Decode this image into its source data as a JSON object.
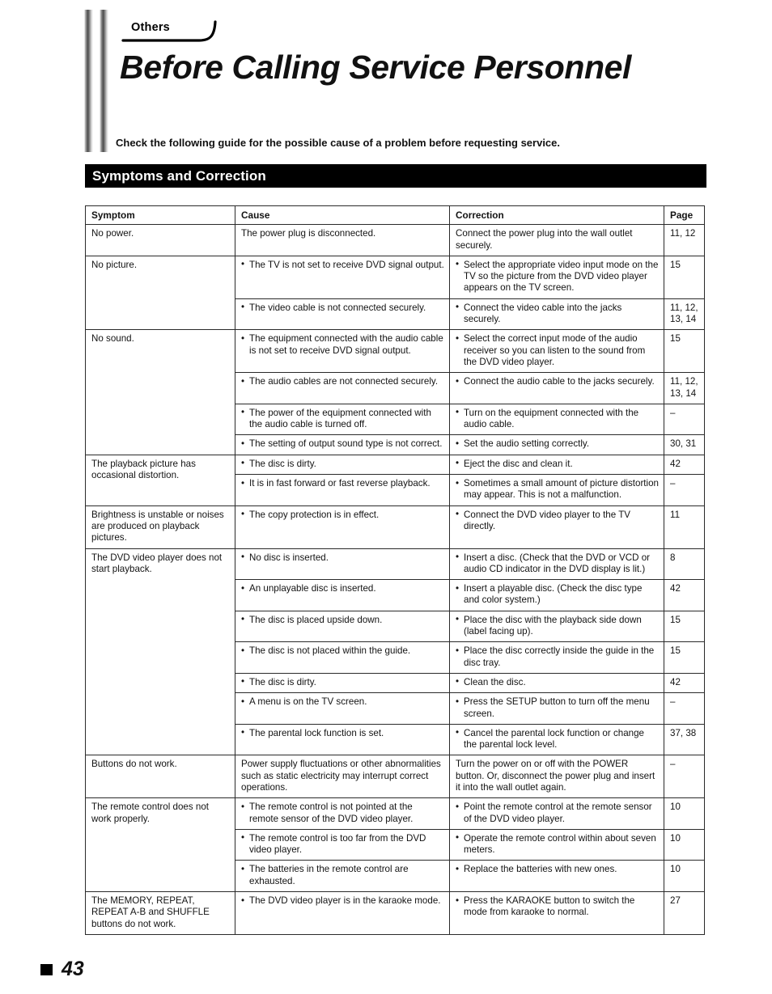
{
  "header": {
    "tab_label": "Others",
    "title": "Before Calling Service Personnel",
    "intro": "Check the following guide for the possible cause of a problem before requesting service.",
    "section_bar_label": "Symptoms and Correction"
  },
  "table": {
    "columns": [
      "Symptom",
      "Cause",
      "Correction",
      "Page"
    ],
    "groups": [
      {
        "symptom": "No power.",
        "rows": [
          {
            "cause": "The power plug is disconnected.",
            "cause_bullet": false,
            "correction": "Connect the power plug into the wall outlet securely.",
            "correction_bullet": false,
            "page": "11, 12"
          }
        ]
      },
      {
        "symptom": "No picture.",
        "rows": [
          {
            "cause": "The TV is not set to receive DVD signal output.",
            "cause_bullet": true,
            "correction": "Select the appropriate video input mode on the TV so the picture from the DVD video player appears on the TV screen.",
            "correction_bullet": true,
            "page": "15"
          },
          {
            "cause": "The video cable is not connected securely.",
            "cause_bullet": true,
            "correction": "Connect the video cable into the jacks securely.",
            "correction_bullet": true,
            "page": "11, 12,\n13, 14"
          }
        ]
      },
      {
        "symptom": "No sound.",
        "rows": [
          {
            "cause": "The equipment connected with the audio cable is not set to receive DVD signal output.",
            "cause_bullet": true,
            "correction": "Select the correct input mode of the audio receiver so you can listen to the sound from the DVD video player.",
            "correction_bullet": true,
            "page": "15"
          },
          {
            "cause": "The audio cables are not connected securely.",
            "cause_bullet": true,
            "correction": "Connect the audio cable to the jacks securely.",
            "correction_bullet": true,
            "page": "11, 12,\n13, 14"
          },
          {
            "cause": "The power of the equipment connected with the audio cable is turned off.",
            "cause_bullet": true,
            "correction": "Turn on the equipment connected with the audio cable.",
            "correction_bullet": true,
            "page": "–"
          },
          {
            "cause": "The setting of output sound type is not correct.",
            "cause_bullet": true,
            "correction": "Set the audio setting correctly.",
            "correction_bullet": true,
            "page": "30, 31"
          }
        ]
      },
      {
        "symptom": "The playback picture has occasional distortion.",
        "rows": [
          {
            "cause": "The disc is dirty.",
            "cause_bullet": true,
            "correction": "Eject the disc and clean it.",
            "correction_bullet": true,
            "page": "42"
          },
          {
            "cause": "It is in fast forward or fast reverse playback.",
            "cause_bullet": true,
            "correction": "Sometimes a small amount of picture distortion may appear. This is not a malfunction.",
            "correction_bullet": true,
            "page": "–"
          }
        ]
      },
      {
        "symptom": "Brightness is unstable or noises are produced on playback pictures.",
        "rows": [
          {
            "cause": "The copy protection is in effect.",
            "cause_bullet": true,
            "correction": "Connect the DVD video player to the TV directly.",
            "correction_bullet": true,
            "page": "11"
          }
        ]
      },
      {
        "symptom": "The DVD video player does not start playback.",
        "rows": [
          {
            "cause": "No disc is inserted.",
            "cause_bullet": true,
            "correction": "Insert a disc. (Check that the DVD or VCD or audio CD indicator in the DVD display is lit.)",
            "correction_bullet": true,
            "page": "8"
          },
          {
            "cause": "An unplayable disc is inserted.",
            "cause_bullet": true,
            "correction": "Insert a playable disc. (Check the disc type and color system.)",
            "correction_bullet": true,
            "page": "42"
          },
          {
            "cause": "The disc is placed upside down.",
            "cause_bullet": true,
            "correction": "Place the disc with the playback side down (label facing up).",
            "correction_bullet": true,
            "page": "15"
          },
          {
            "cause": "The disc is not placed within the guide.",
            "cause_bullet": true,
            "correction": "Place the disc correctly inside the guide in the disc tray.",
            "correction_bullet": true,
            "page": "15"
          },
          {
            "cause": "The disc is dirty.",
            "cause_bullet": true,
            "correction": "Clean the disc.",
            "correction_bullet": true,
            "page": "42"
          },
          {
            "cause": "A menu is on the TV screen.",
            "cause_bullet": true,
            "correction": "Press the SETUP button to turn off the menu screen.",
            "correction_bullet": true,
            "page": "–"
          },
          {
            "cause": "The parental lock function is set.",
            "cause_bullet": true,
            "correction": "Cancel the parental lock function or change the parental lock level.",
            "correction_bullet": true,
            "page": "37, 38"
          }
        ]
      },
      {
        "symptom": "Buttons do not work.",
        "rows": [
          {
            "cause": "Power supply fluctuations or other abnormalities such as static electricity may interrupt correct operations.",
            "cause_bullet": false,
            "correction": "Turn the power on or off with the POWER button. Or, disconnect the power plug and insert it into the wall outlet again.",
            "correction_bullet": false,
            "page": "–"
          }
        ]
      },
      {
        "symptom": "The remote control does not work properly.",
        "rows": [
          {
            "cause": "The remote control is not pointed at the remote sensor of the DVD video player.",
            "cause_bullet": true,
            "correction": "Point the remote control at the remote sensor of the DVD video player.",
            "correction_bullet": true,
            "page": "10"
          },
          {
            "cause": "The remote control is too far from the DVD video player.",
            "cause_bullet": true,
            "correction": "Operate the remote control within about seven meters.",
            "correction_bullet": true,
            "page": "10"
          },
          {
            "cause": "The batteries in the remote control are exhausted.",
            "cause_bullet": true,
            "correction": "Replace the batteries with new ones.",
            "correction_bullet": true,
            "page": "10"
          }
        ]
      },
      {
        "symptom": "The MEMORY, REPEAT, REPEAT A-B and SHUFFLE buttons do not work.",
        "rows": [
          {
            "cause": "The DVD video player is in the karaoke mode.",
            "cause_bullet": true,
            "correction": "Press the KARAOKE button to switch the mode from karaoke to normal.",
            "correction_bullet": true,
            "page": "27"
          }
        ]
      }
    ]
  },
  "footer": {
    "page_number": "43"
  }
}
